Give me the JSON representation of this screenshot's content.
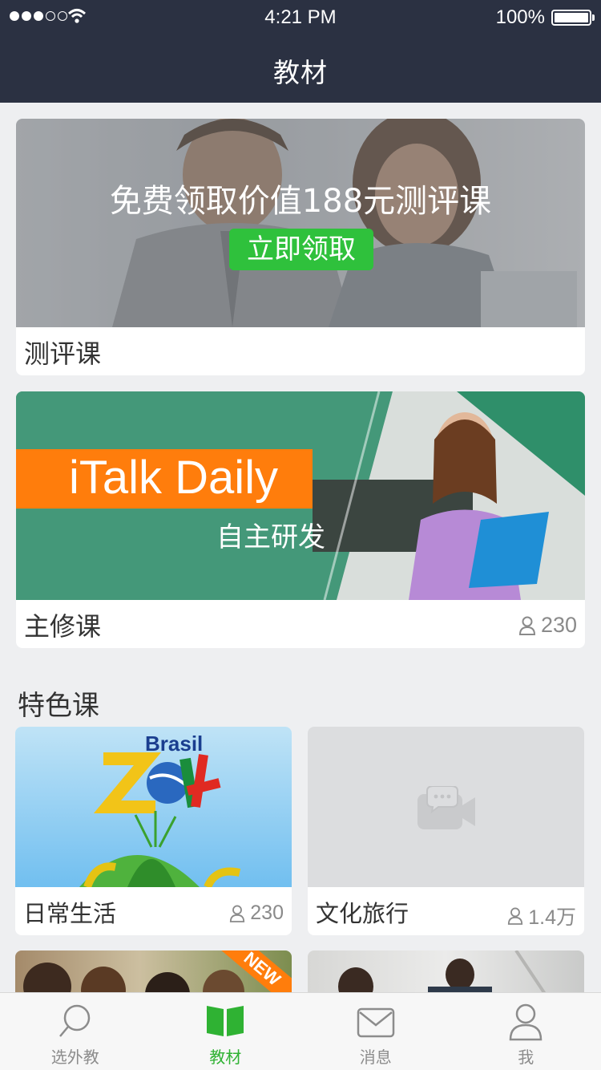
{
  "status_bar": {
    "time": "4:21 PM",
    "battery": "100%"
  },
  "header": {
    "title": "教材"
  },
  "banner_assessment": {
    "headline": "免费领取价值188元测评课",
    "button_label": "立即领取",
    "card_label": "测评课"
  },
  "banner_main": {
    "title": "iTalk Daily",
    "subtitle": "自主研发",
    "card_label": "主修课",
    "count": "230"
  },
  "featured": {
    "section_title": "特色课",
    "items": [
      {
        "label": "日常生活",
        "count": "230",
        "image_text": "Brasil"
      },
      {
        "label": "文化旅行",
        "count": "1.4万"
      }
    ],
    "ribbon": "NEW"
  },
  "tabbar": {
    "active_color": "#2fb233",
    "tabs": [
      {
        "label": "选外教",
        "icon": "search-icon"
      },
      {
        "label": "教材",
        "icon": "book-icon"
      },
      {
        "label": "消息",
        "icon": "mail-icon"
      },
      {
        "label": "我",
        "icon": "person-icon"
      }
    ]
  }
}
